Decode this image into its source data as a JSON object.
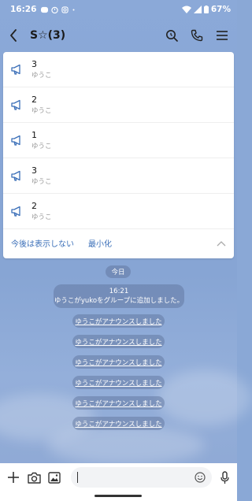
{
  "status_bar": {
    "time": "16:26",
    "battery": "67%"
  },
  "header": {
    "title": "S☆(3)"
  },
  "announcements": [
    {
      "number": "3",
      "author": "ゆうこ"
    },
    {
      "number": "2",
      "author": "ゆうこ"
    },
    {
      "number": "1",
      "author": "ゆうこ"
    },
    {
      "number": "3",
      "author": "ゆうこ"
    },
    {
      "number": "2",
      "author": "ゆうこ"
    }
  ],
  "panel_footer": {
    "hide_label": "今後は表示しない",
    "minimize_label": "最小化"
  },
  "chat": {
    "date_label": "今日",
    "system_time": "16:21",
    "system_message": "ゆうこがyukoをグループに追加しました。",
    "announce_messages": [
      "ゆうこがアナウンスしました",
      "ゆうこがアナウンスしました",
      "ゆうこがアナウンスしました",
      "ゆうこがアナウンスしました",
      "ゆうこがアナウンスしました",
      "ゆうこがアナウンスしました"
    ]
  },
  "colors": {
    "accent": "#3b6fb8",
    "background": "#8aa8d6",
    "pill": "#5a6e96"
  }
}
